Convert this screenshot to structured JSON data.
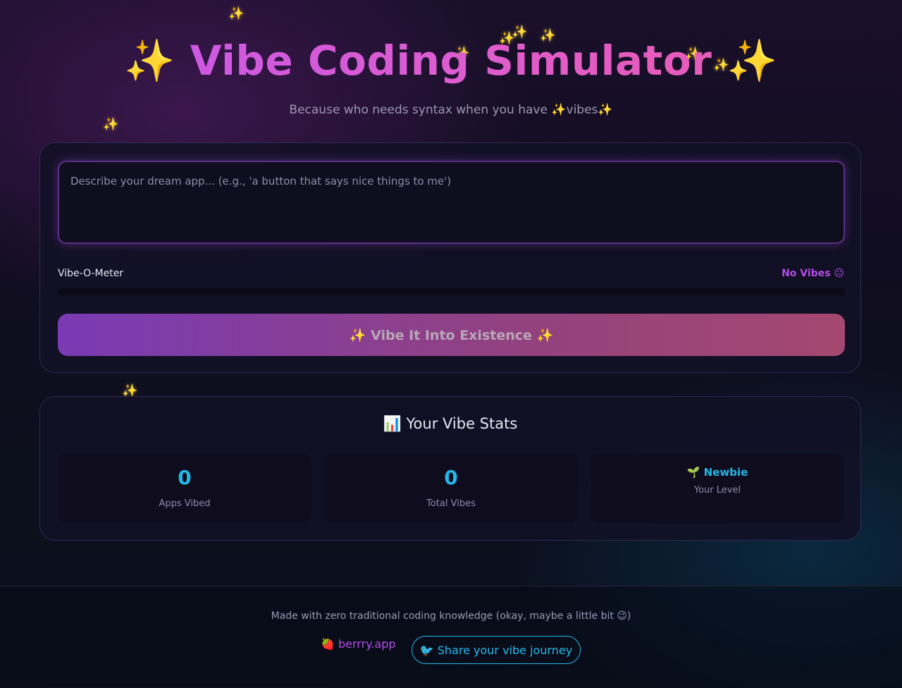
{
  "header": {
    "title": "Vibe Coding Simulator",
    "title_emoji_left": "✨",
    "title_emoji_right": "✨",
    "subtitle": "Because who needs syntax when you have ✨vibes✨"
  },
  "decorations": {
    "sparkle_icon": "sparkle-icon",
    "sparkle_glyph": "✨"
  },
  "input": {
    "placeholder": "Describe your dream app... (e.g., 'a button that says nice things to me')",
    "value": ""
  },
  "meter": {
    "label": "Vibe-O-Meter",
    "status": "No Vibes 😐",
    "level_fraction": 0
  },
  "action": {
    "button_label": "✨ Vibe It Into Existence ✨"
  },
  "stats": {
    "title": "📊 Your Vibe Stats",
    "apps_vibed": {
      "value": "0",
      "label": "Apps Vibed"
    },
    "total_vibes": {
      "value": "0",
      "label": "Total Vibes"
    },
    "level": {
      "value": "🌱 Newbie",
      "label": "Your Level"
    }
  },
  "footer": {
    "text": "Made with zero traditional coding knowledge (okay, maybe a little bit 😉)",
    "link_label": "🍓 berrry.app",
    "share_label": "🐦 Share your vibe journey"
  },
  "colors": {
    "accent_purple": "#b24ee6",
    "accent_cyan": "#22b8e8",
    "title_gradient_start": "#c155ee",
    "title_gradient_end": "#ef5aa8"
  }
}
